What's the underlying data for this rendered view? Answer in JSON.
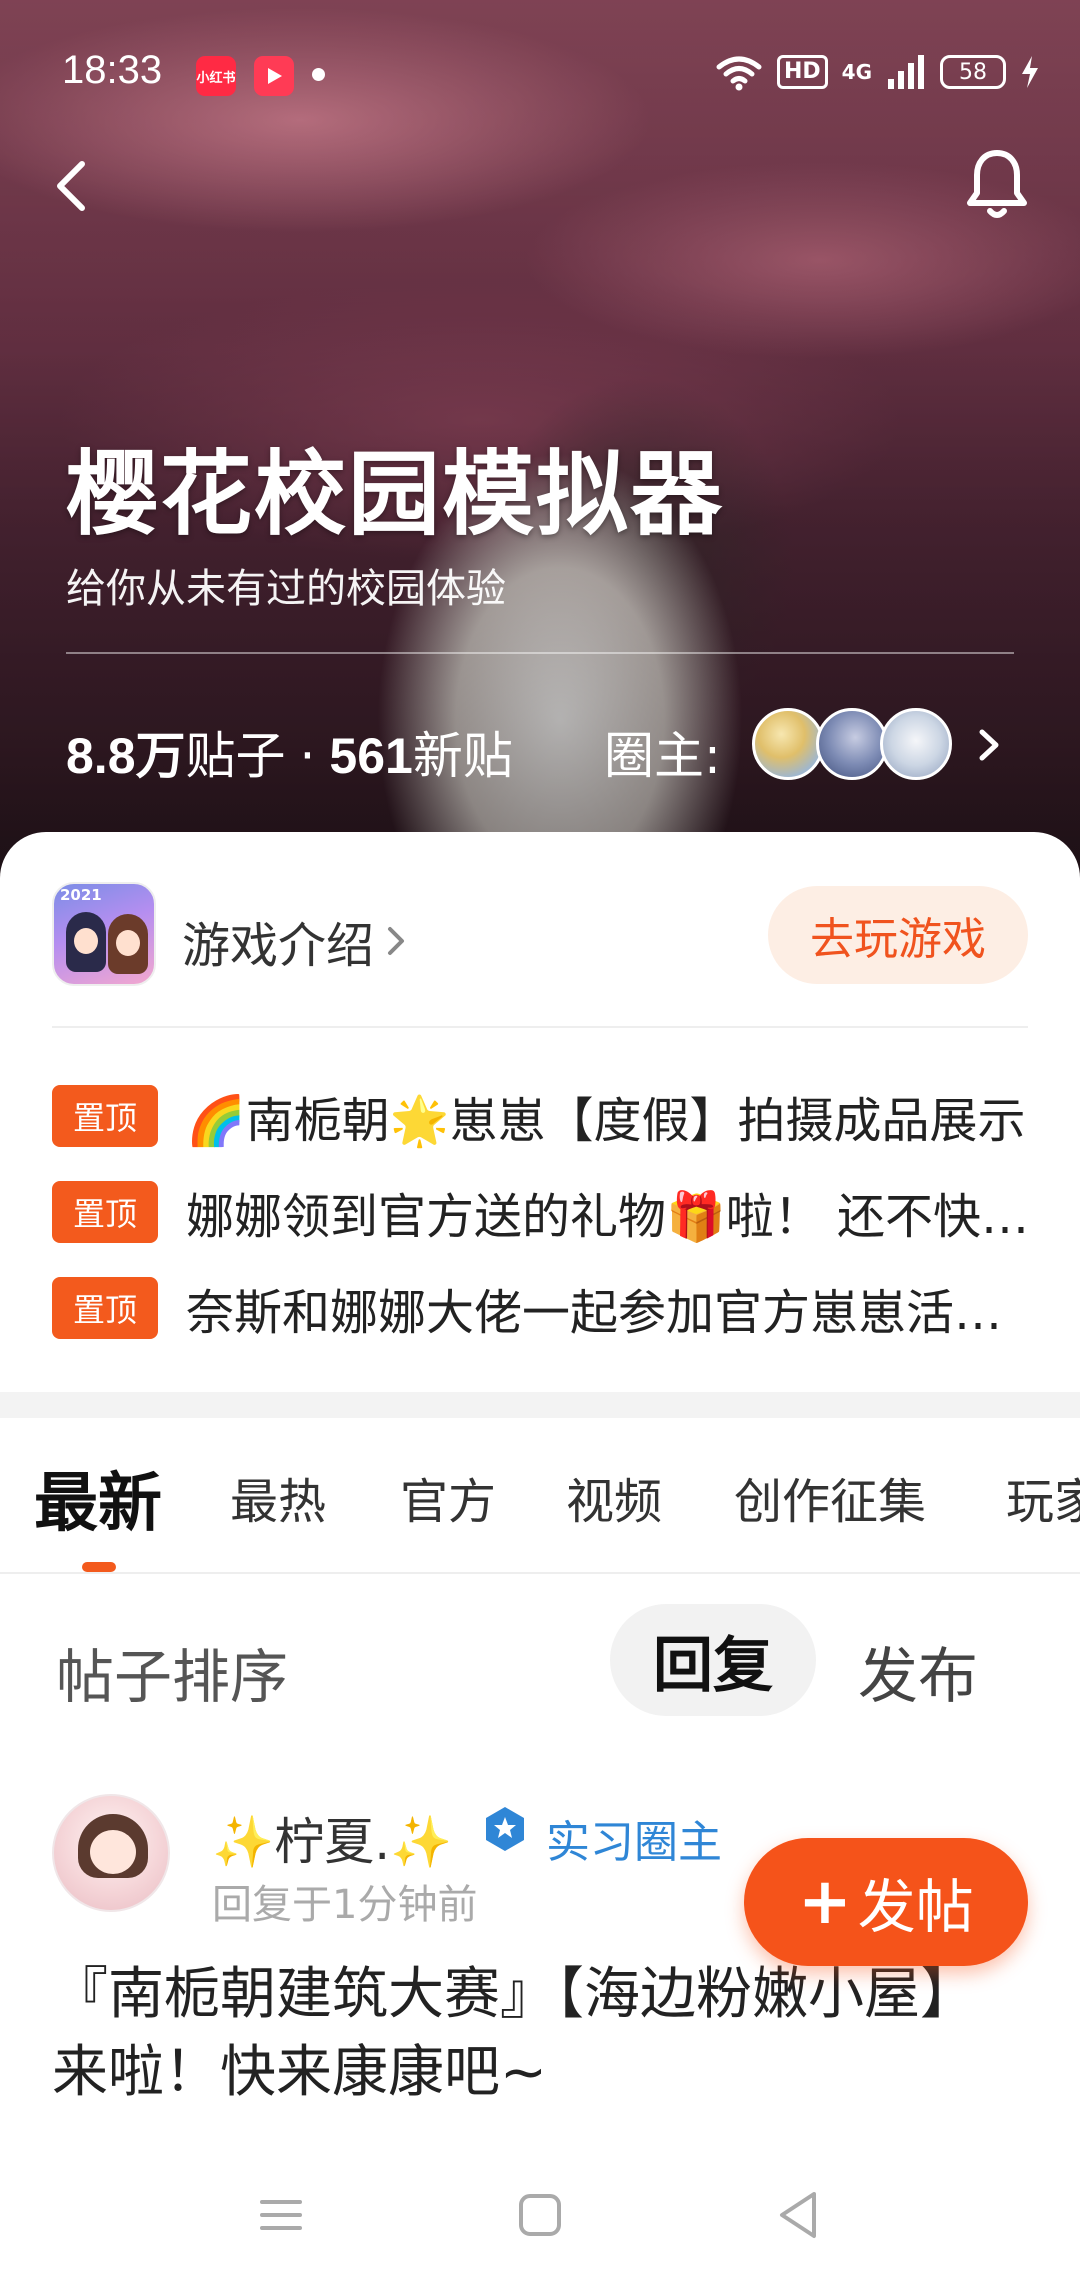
{
  "status_bar": {
    "time": "18:33",
    "app_badge_1": "小红书",
    "network": "4G",
    "hd": "HD",
    "battery": "58"
  },
  "header": {
    "title": "樱花校园模拟器",
    "subtitle": "给你从未有过的校园体验",
    "posts_count": "8.8万",
    "posts_label": "贴子",
    "separator": "·",
    "new_count": "561",
    "new_label": "新贴",
    "owner_label": "圈主:"
  },
  "game": {
    "icon_year": "2021",
    "intro_label": "游戏介绍",
    "play_button": "去玩游戏"
  },
  "pinned": [
    {
      "tag": "置顶",
      "text": "🌈南栀朝🌟崽崽【度假】拍摄成品展示"
    },
    {
      "tag": "置顶",
      "text": "娜娜领到官方送的礼物🎁啦！ 还不快来看看"
    },
    {
      "tag": "置顶",
      "text": "奈斯和娜娜大佬一起参加官方崽崽活动啦"
    }
  ],
  "tabs": [
    "最新",
    "最热",
    "官方",
    "视频",
    "创作征集",
    "玩家"
  ],
  "sort": {
    "label": "帖子排序",
    "reply": "回复",
    "publish": "发布"
  },
  "post": {
    "author": "✨柠夏.✨",
    "role": "实习圈主",
    "time": "回复于1分钟前",
    "title": "『南栀朝建筑大赛』【海边粉嫩小屋】来啦！快来康康吧~"
  },
  "fab": {
    "plus": "+",
    "label": "发帖"
  },
  "colors": {
    "accent": "#f35a1d",
    "role_blue": "#2f86d6",
    "play_bg": "#fdeee4"
  }
}
